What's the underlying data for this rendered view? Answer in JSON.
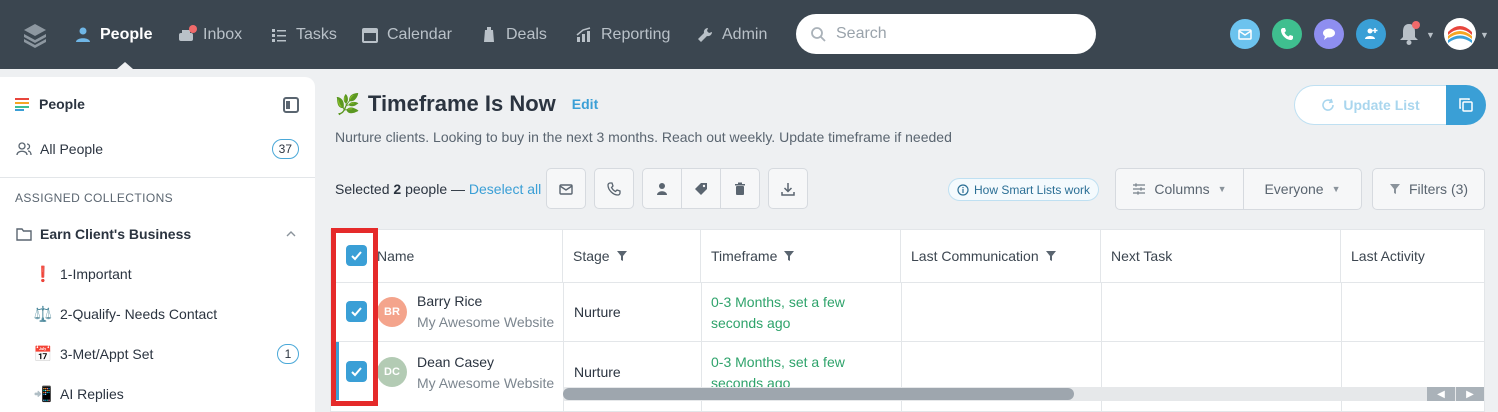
{
  "nav": {
    "items": [
      {
        "label": "People",
        "icon": "people-icon",
        "active": true
      },
      {
        "label": "Inbox",
        "icon": "inbox-icon",
        "active": false
      },
      {
        "label": "Tasks",
        "icon": "tasks-icon",
        "active": false
      },
      {
        "label": "Calendar",
        "icon": "calendar-icon",
        "active": false
      },
      {
        "label": "Deals",
        "icon": "deals-icon",
        "active": false
      },
      {
        "label": "Reporting",
        "icon": "reporting-icon",
        "active": false
      },
      {
        "label": "Admin",
        "icon": "wrench-icon",
        "active": false
      }
    ],
    "search_placeholder": "Search"
  },
  "sidebar": {
    "title": "People",
    "all_people": {
      "label": "All People",
      "count": "37"
    },
    "section_heading": "ASSIGNED COLLECTIONS",
    "collection": {
      "label": "Earn Client's Business"
    },
    "items": [
      {
        "icon": "❗",
        "label": "1-Important",
        "count": ""
      },
      {
        "icon": "⚖️",
        "label": "2-Qualify- Needs Contact",
        "count": ""
      },
      {
        "icon": "📅",
        "label": "3-Met/Appt Set",
        "count": "1"
      },
      {
        "icon": "📲",
        "label": "AI Replies",
        "count": ""
      }
    ]
  },
  "main": {
    "title_emoji": "🌿",
    "title": "Timeframe Is Now",
    "edit_label": "Edit",
    "subtitle": "Nurture clients. Looking to buy in the next 3 months. Reach out weekly. Update timeframe if needed",
    "update_list_label": "Update List",
    "selected_prefix": "Selected",
    "selected_count": "2",
    "selected_suffix": "people —",
    "deselect_label": "Deselect all",
    "smart_lists_label": "How Smart Lists work",
    "columns_label": "Columns",
    "everyone_label": "Everyone",
    "filters_label": "Filters (3)"
  },
  "table": {
    "headers": [
      "Name",
      "Stage",
      "Timeframe",
      "Last Communication",
      "Next Task",
      "Last Activity"
    ],
    "rows": [
      {
        "initials": "BR",
        "name": "Barry Rice",
        "site": "My Awesome Website",
        "stage": "Nurture",
        "timeframe_line1": "0-3 Months, set a few",
        "timeframe_line2": "seconds ago",
        "avatar_color": "#f4a48c"
      },
      {
        "initials": "DC",
        "name": "Dean Casey",
        "site": "My Awesome Website",
        "stage": "Nurture",
        "timeframe_line1": "0-3 Months, set a few",
        "timeframe_line2": "seconds ago",
        "avatar_color": "#b3cbb4"
      }
    ]
  },
  "colors": {
    "nav_bg": "#3b4650",
    "accent": "#3a9fd6",
    "timeframe_green": "#2fa36b",
    "highlight_red": "#e52a2a"
  }
}
